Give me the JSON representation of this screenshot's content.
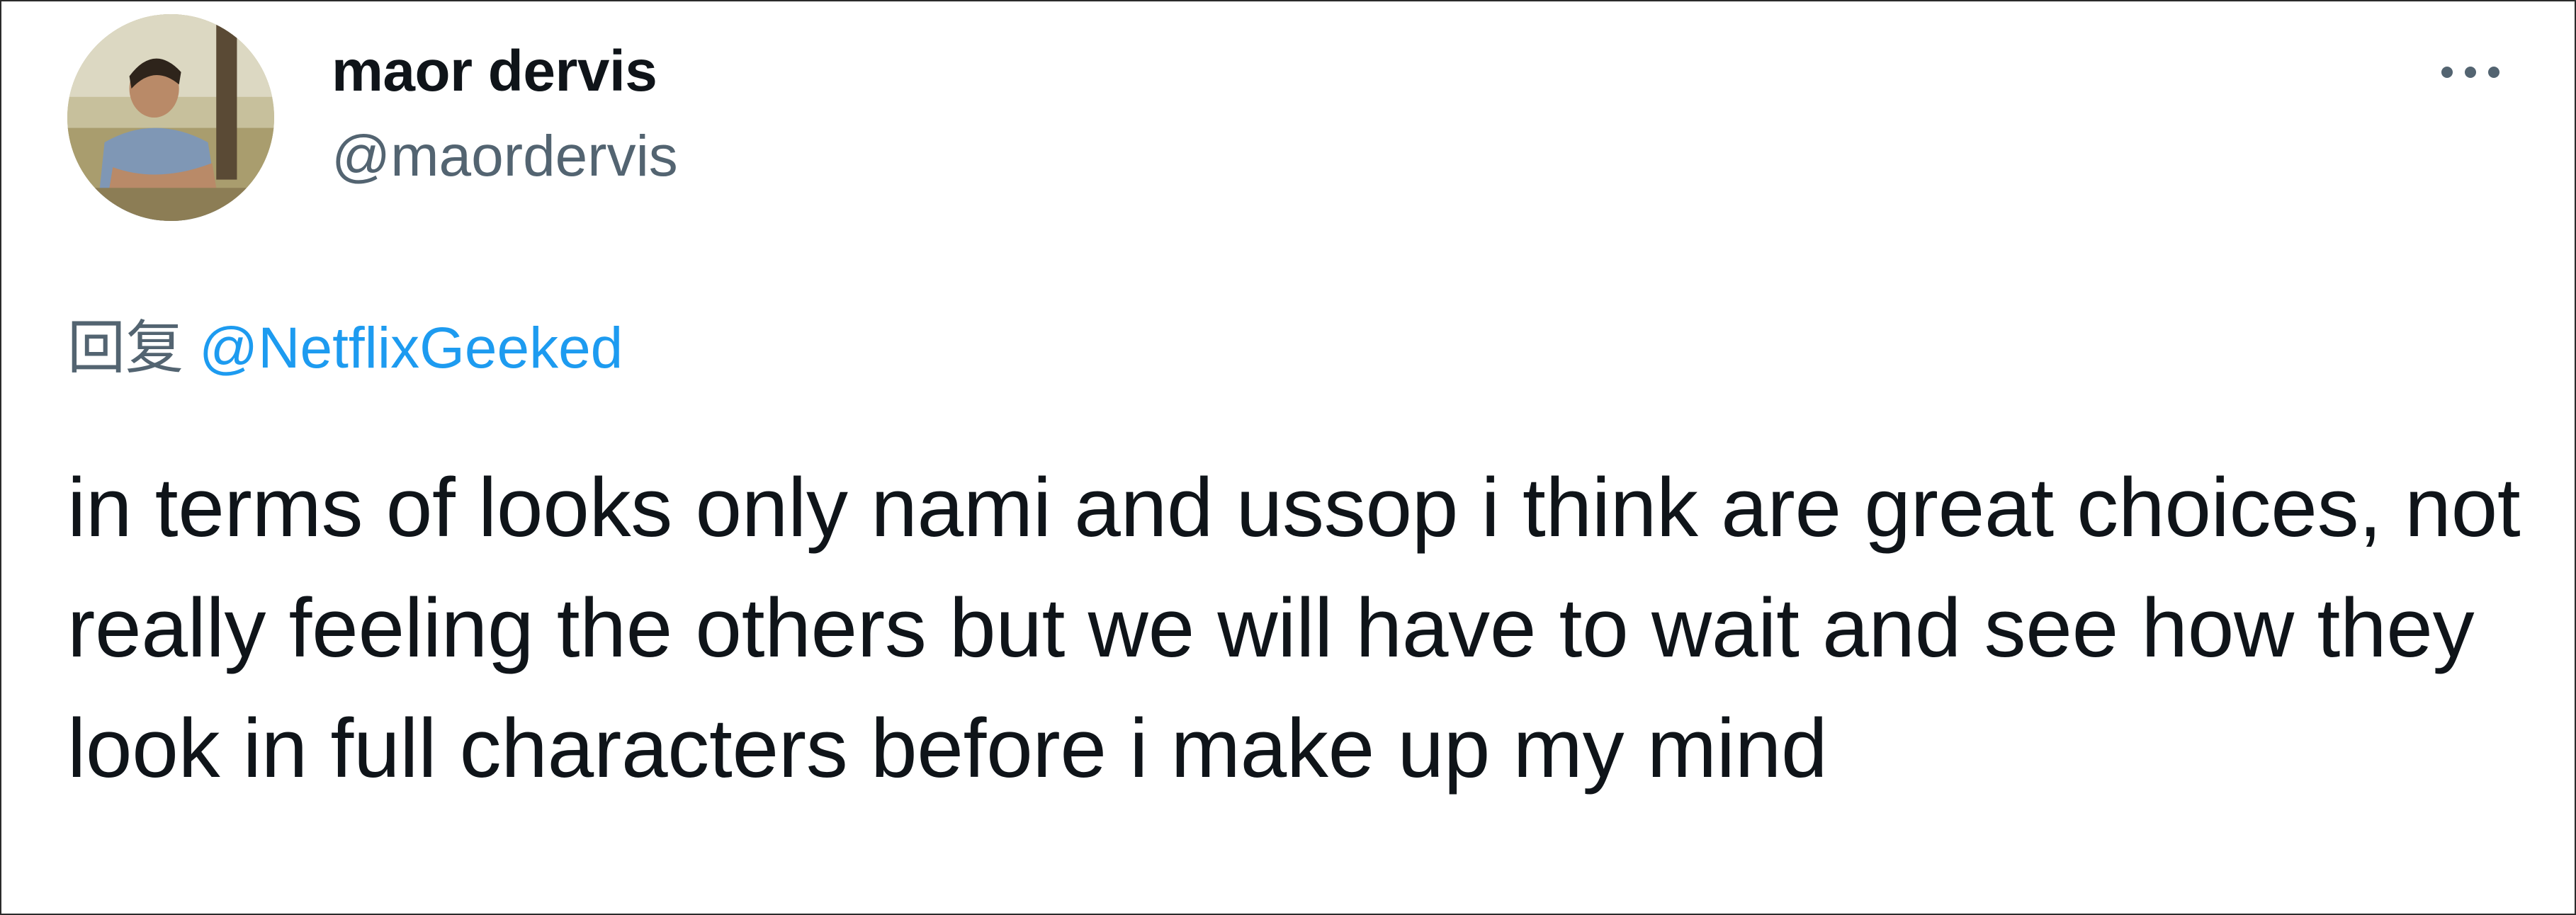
{
  "author": {
    "display_name": "maor dervis",
    "handle": "@maordervis",
    "avatar_icon": "user-photo-avatar"
  },
  "menu": {
    "icon": "more-horizontal-icon"
  },
  "reply": {
    "prefix": "回复",
    "to_handle": "@NetflixGeeked"
  },
  "tweet": {
    "text": "in terms of looks only nami and ussop i think are great choices, not really feeling the others but we will have to wait and see how they look in full characters before i make up my mind"
  },
  "colors": {
    "link": "#1d9bf0",
    "secondary_text": "#536471",
    "primary_text": "#0f1419"
  }
}
